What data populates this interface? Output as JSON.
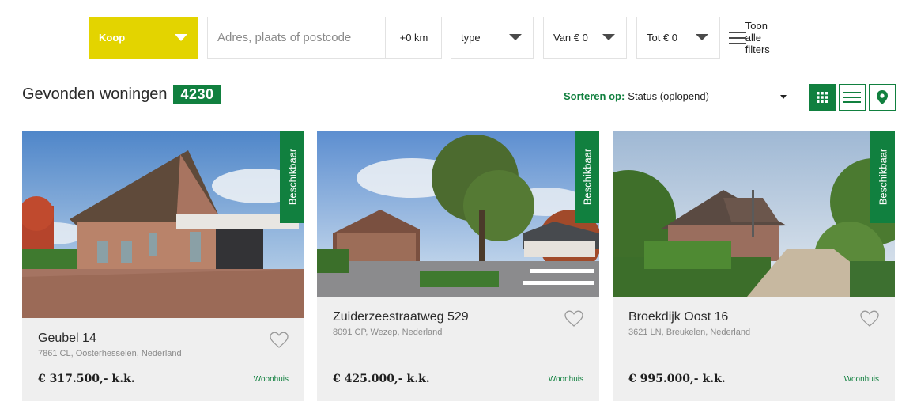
{
  "filters": {
    "mode": "Koop",
    "search_placeholder": "Adres, plaats of postcode",
    "radius": "+0 km",
    "type": "type",
    "price_from": "Van € 0",
    "price_to": "Tot € 0",
    "all_filters": "Toon alle filters"
  },
  "results": {
    "label": "Gevonden woningen",
    "count": "4230",
    "sort_label": "Sorteren op:",
    "sort_value": "Status (oplopend)",
    "views": [
      "grid-view",
      "list-view",
      "map-view"
    ],
    "active_view": "grid-view"
  },
  "colors": {
    "brand_green": "#11803f",
    "accent_yellow": "#e3d400"
  },
  "listings": [
    {
      "status": "Beschikbaar",
      "title": "Geubel 14",
      "address": "7861 CL, Oosterhesselen, Nederland",
      "price": "€ 317.500,- k.k.",
      "type": "Woonhuis"
    },
    {
      "status": "Beschikbaar",
      "title": "Zuiderzeestraatweg 529",
      "address": "8091 CP, Wezep, Nederland",
      "price": "€ 425.000,- k.k.",
      "type": "Woonhuis"
    },
    {
      "status": "Beschikbaar",
      "title": "Broekdijk Oost 16",
      "address": "3621 LN, Breukelen, Nederland",
      "price": "€ 995.000,- k.k.",
      "type": "Woonhuis"
    }
  ]
}
